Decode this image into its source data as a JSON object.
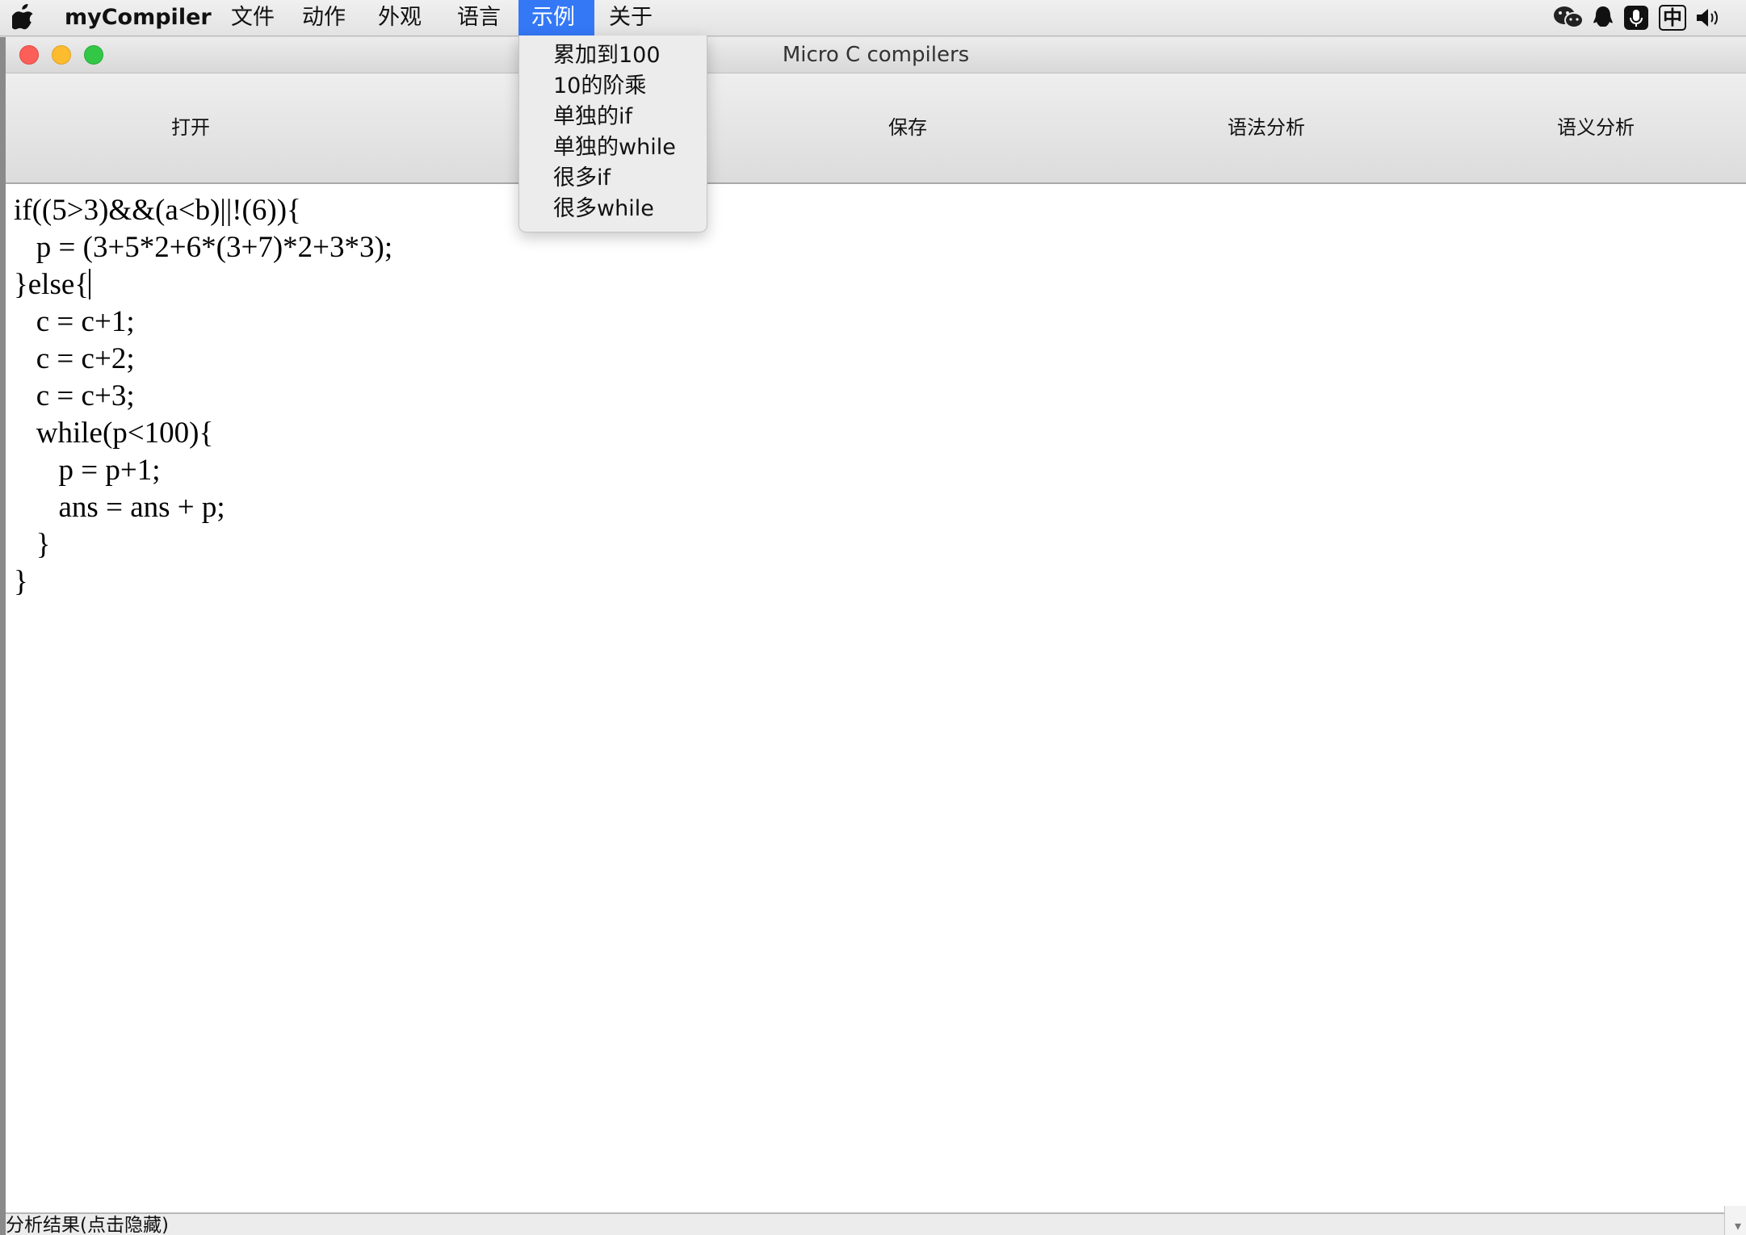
{
  "menubar": {
    "apple_icon": "apple-logo-icon",
    "app_name": "myCompiler",
    "items": [
      "文件",
      "动作",
      "外观",
      "语言",
      "示例",
      "关于"
    ],
    "active_item": "示例",
    "status_icons": [
      "wechat-icon",
      "qq-icon",
      "microphone-icon",
      "input-method-icon",
      "volume-icon"
    ],
    "input_method_label": "中"
  },
  "dropdown": {
    "items": [
      "累加到100",
      "10的阶乘",
      "单独的if",
      "单独的while",
      "很多if",
      "很多while"
    ]
  },
  "window": {
    "title": "Micro C compilers",
    "toolbar": {
      "open": "打开",
      "save": "保存",
      "lexical": "语法分析",
      "semantic": "语义分析"
    },
    "editor": {
      "lines": [
        "if((5>3)&&(a<b)||!(6)){",
        "   p = (3+5*2+6*(3+7)*2+3*3);",
        "}else{",
        "   c = c+1;",
        "   c = c+2;",
        "   c = c+3;",
        "   while(p<100){",
        "      p = p+1;",
        "      ans = ans + p;",
        "   }",
        "}"
      ]
    },
    "result_label": "分析结果(点击隐藏)"
  },
  "colors": {
    "menu_highlight": "#3478f6",
    "close": "#fc5f57",
    "minimize": "#fdbc2e",
    "maximize": "#33c748"
  }
}
